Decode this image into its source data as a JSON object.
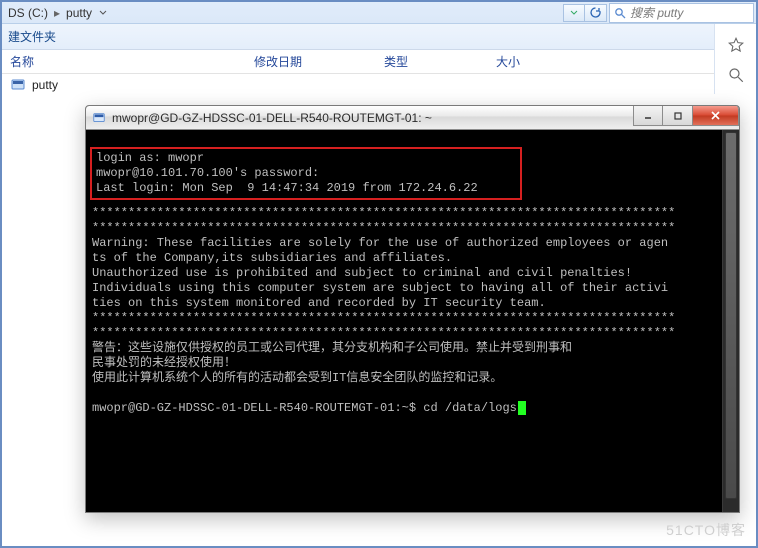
{
  "explorer": {
    "breadcrumb": {
      "drive": "DS (C:)",
      "folder": "putty"
    },
    "search_placeholder": "搜索 putty",
    "toolbar": {
      "new_folder": "建文件夹"
    },
    "columns": {
      "name": "名称",
      "date": "修改日期",
      "type": "类型",
      "size": "大小"
    },
    "file": "putty"
  },
  "putty": {
    "title": "mwopr@GD-GZ-HDSSC-01-DELL-R540-ROUTEMGT-01: ~",
    "login_block": {
      "line1": "login as: mwopr",
      "line2": "mwopr@10.101.70.100's password:",
      "line3": "Last login: Mon Sep  9 14:47:34 2019 from 172.24.6.22"
    },
    "stars1": "*********************************************************************************",
    "stars2": "*********************************************************************************",
    "warn1": "Warning: These facilities are solely for the use of authorized employees or agen",
    "warn2": "ts of the Company,its subsidiaries and affiliates.",
    "warn3": "Unauthorized use is prohibited and subject to criminal and civil penalties!",
    "warn4": "Individuals using this computer system are subject to having all of their activi",
    "warn5": "ties on this system monitored and recorded by IT security team.",
    "stars3": "*********************************************************************************",
    "stars4": "*********************************************************************************",
    "cn1": "警告：这些设施仅供授权的员工或公司代理，其分支机构和子公司使用。禁止并受到刑事和",
    "cn2": "民事处罚的未经授权使用！",
    "cn3": "使用此计算机系统个人的所有的活动都会受到IT信息安全团队的监控和记录。",
    "prompt": "mwopr@GD-GZ-HDSSC-01-DELL-R540-ROUTEMGT-01:~$ ",
    "command": "cd /data/logs"
  },
  "watermark": "51CTO博客"
}
